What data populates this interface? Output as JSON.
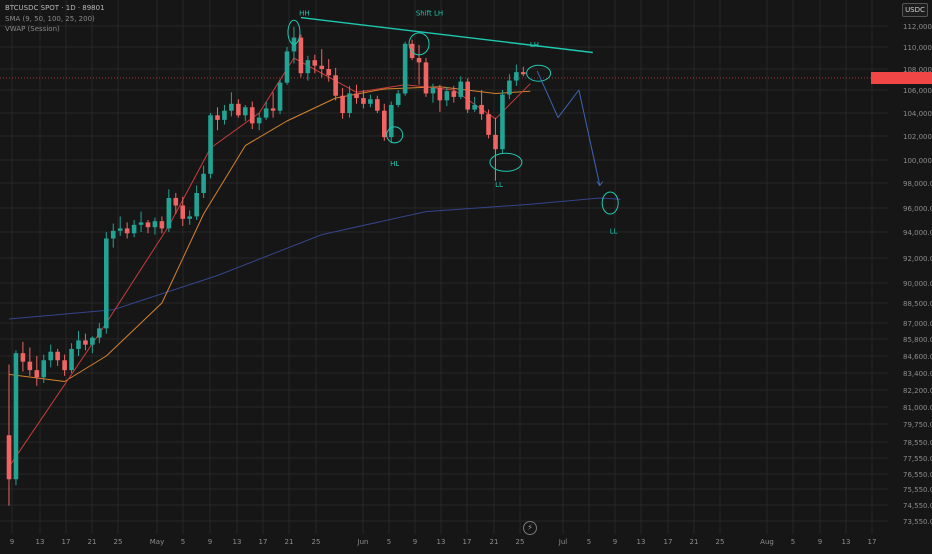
{
  "legend": {
    "symbol": "BTCUSDC SPOT · 1D · 89801",
    "moving_averages": "SMA (9, 50, 100, 25, 200)",
    "vwap": "VWAP (Session)"
  },
  "currency_button": "USDC",
  "replay_icon": "lightning-icon",
  "colors": {
    "up": "#22a393",
    "down": "#f06464",
    "sma_fast": "#c83c3c",
    "sma_mid": "#d7822d",
    "sma_long": "#34448c",
    "trend": "#1fc8b0",
    "projection": "#3c64b4",
    "price_tag": "#f04646",
    "grid": "#262626",
    "background": "#161616"
  },
  "price_axis": [
    "112,000.0",
    "110,000.0",
    "108,000.0",
    "106,000.0",
    "104,000.0",
    "102,000.0",
    "100,000.0",
    "98,000.0",
    "96,000.0",
    "94,000.0",
    "92,000.0",
    "90,000.0",
    "88,500.0",
    "87,000.0",
    "85,800.0",
    "84,600.0",
    "83,400.0",
    "82,200.0",
    "81,000.0",
    "79,750.0",
    "78,550.0",
    "77,550.0",
    "76,550.0",
    "75,550.0",
    "74,550.0",
    "73,550.0"
  ],
  "date_axis": [
    "9",
    "13",
    "17",
    "21",
    "25",
    "May",
    "5",
    "9",
    "13",
    "17",
    "21",
    "25",
    "Jun",
    "5",
    "9",
    "13",
    "17",
    "21",
    "25",
    "Jul",
    "5",
    "9",
    "13",
    "17",
    "21",
    "25",
    "Aug",
    "5",
    "9",
    "13",
    "17"
  ],
  "annotations": {
    "hh": "HH",
    "shift": "Shift LH",
    "lh": "LH",
    "hl": "HL",
    "ll_mid": "LL",
    "ll_right": "LL"
  },
  "chart_data": {
    "type": "candlestick",
    "ohlc": [
      [
        79000,
        84000,
        74500,
        76200
      ],
      [
        76200,
        85000,
        75800,
        84800
      ],
      [
        84800,
        85600,
        83500,
        84200
      ],
      [
        84200,
        85200,
        83200,
        83600
      ],
      [
        83600,
        84600,
        82500,
        83100
      ],
      [
        83100,
        84700,
        82700,
        84300
      ],
      [
        84300,
        85400,
        83800,
        84900
      ],
      [
        84900,
        85100,
        83900,
        84300
      ],
      [
        84300,
        84700,
        83200,
        83600
      ],
      [
        83600,
        85500,
        83400,
        85100
      ],
      [
        85100,
        86400,
        84600,
        85700
      ],
      [
        85700,
        86200,
        85000,
        85400
      ],
      [
        85400,
        86000,
        84800,
        85900
      ],
      [
        85900,
        87000,
        85500,
        86600
      ],
      [
        86600,
        94000,
        86200,
        93500
      ],
      [
        93500,
        94700,
        92800,
        94100
      ],
      [
        94100,
        95300,
        93700,
        94300
      ],
      [
        94300,
        94800,
        93500,
        93900
      ],
      [
        93900,
        95000,
        93600,
        94600
      ],
      [
        94600,
        95700,
        94000,
        94800
      ],
      [
        94800,
        95000,
        93900,
        94400
      ],
      [
        94400,
        95200,
        93800,
        94900
      ],
      [
        94900,
        95300,
        93900,
        94300
      ],
      [
        94300,
        97500,
        94000,
        96800
      ],
      [
        96800,
        97200,
        95500,
        96200
      ],
      [
        96200,
        96900,
        94500,
        95100
      ],
      [
        95100,
        95800,
        94600,
        95300
      ],
      [
        95300,
        97800,
        95000,
        97200
      ],
      [
        97200,
        99500,
        96800,
        98800
      ],
      [
        98800,
        104000,
        98400,
        103800
      ],
      [
        103800,
        104500,
        102500,
        103400
      ],
      [
        103400,
        104700,
        103000,
        104200
      ],
      [
        104200,
        105800,
        103700,
        104800
      ],
      [
        104800,
        105200,
        103600,
        103800
      ],
      [
        103800,
        104700,
        103300,
        104500
      ],
      [
        104500,
        105000,
        102600,
        103100
      ],
      [
        103100,
        104000,
        102500,
        103600
      ],
      [
        103600,
        105000,
        103400,
        104400
      ],
      [
        104400,
        105800,
        103600,
        104200
      ],
      [
        104200,
        107000,
        103900,
        106700
      ],
      [
        106700,
        110000,
        106500,
        109600
      ],
      [
        109600,
        111900,
        108500,
        110900
      ],
      [
        110900,
        111200,
        107200,
        107600
      ],
      [
        107600,
        109200,
        106900,
        108800
      ],
      [
        108800,
        109300,
        107600,
        108300
      ],
      [
        108300,
        109800,
        107200,
        108000
      ],
      [
        108000,
        108900,
        106800,
        107400
      ],
      [
        107400,
        108100,
        105100,
        105500
      ],
      [
        105500,
        106200,
        103500,
        104000
      ],
      [
        104000,
        106400,
        103600,
        105700
      ],
      [
        105700,
        106500,
        104800,
        105300
      ],
      [
        105300,
        106000,
        104400,
        104800
      ],
      [
        104800,
        105600,
        104500,
        105200
      ],
      [
        105200,
        105500,
        104000,
        104200
      ],
      [
        104200,
        104800,
        101600,
        101900
      ],
      [
        101900,
        105000,
        101400,
        104700
      ],
      [
        104700,
        106000,
        104500,
        105700
      ],
      [
        105700,
        110500,
        105500,
        110300
      ],
      [
        110300,
        110700,
        108800,
        109000
      ],
      [
        109000,
        110200,
        106500,
        108600
      ],
      [
        108600,
        109000,
        105400,
        105700
      ],
      [
        105700,
        106600,
        104900,
        106200
      ],
      [
        106200,
        106500,
        104100,
        105100
      ],
      [
        105100,
        106300,
        104600,
        105900
      ],
      [
        105900,
        106400,
        104900,
        105400
      ],
      [
        105400,
        107300,
        105200,
        106800
      ],
      [
        106800,
        107100,
        104000,
        104300
      ],
      [
        104300,
        105400,
        104100,
        104700
      ],
      [
        104700,
        106000,
        103400,
        103900
      ],
      [
        103900,
        104300,
        101800,
        102100
      ],
      [
        102100,
        103600,
        98200,
        100900
      ],
      [
        100900,
        106000,
        100500,
        105600
      ],
      [
        105600,
        107500,
        105200,
        106900
      ],
      [
        106900,
        108400,
        106400,
        107700
      ],
      [
        107700,
        108200,
        107300,
        107500
      ]
    ],
    "sma_fast": [
      [
        0,
        77000
      ],
      [
        14,
        87000
      ],
      [
        23,
        94500
      ],
      [
        29,
        101000
      ],
      [
        36,
        104000
      ],
      [
        41,
        109000
      ],
      [
        50,
        105800
      ],
      [
        57,
        106500
      ],
      [
        64,
        106000
      ],
      [
        70,
        103500
      ],
      [
        75,
        106600
      ]
    ],
    "sma_mid": [
      [
        0,
        83300
      ],
      [
        8,
        82800
      ],
      [
        14,
        84600
      ],
      [
        22,
        88500
      ],
      [
        28,
        95500
      ],
      [
        34,
        101200
      ],
      [
        40,
        103300
      ],
      [
        47,
        105300
      ],
      [
        54,
        106100
      ],
      [
        62,
        106300
      ],
      [
        70,
        105700
      ],
      [
        75,
        105900
      ]
    ],
    "sma_long": [
      [
        0,
        87300
      ],
      [
        15,
        88000
      ],
      [
        30,
        90600
      ],
      [
        45,
        93800
      ],
      [
        60,
        95700
      ],
      [
        75,
        96300
      ],
      [
        85,
        96800
      ],
      [
        88,
        96700
      ]
    ],
    "trendline": [
      [
        42,
        112800
      ],
      [
        84,
        109500
      ]
    ],
    "projection": [
      [
        76,
        107800
      ],
      [
        79,
        103600
      ],
      [
        82,
        106000
      ],
      [
        85,
        97800
      ]
    ]
  }
}
